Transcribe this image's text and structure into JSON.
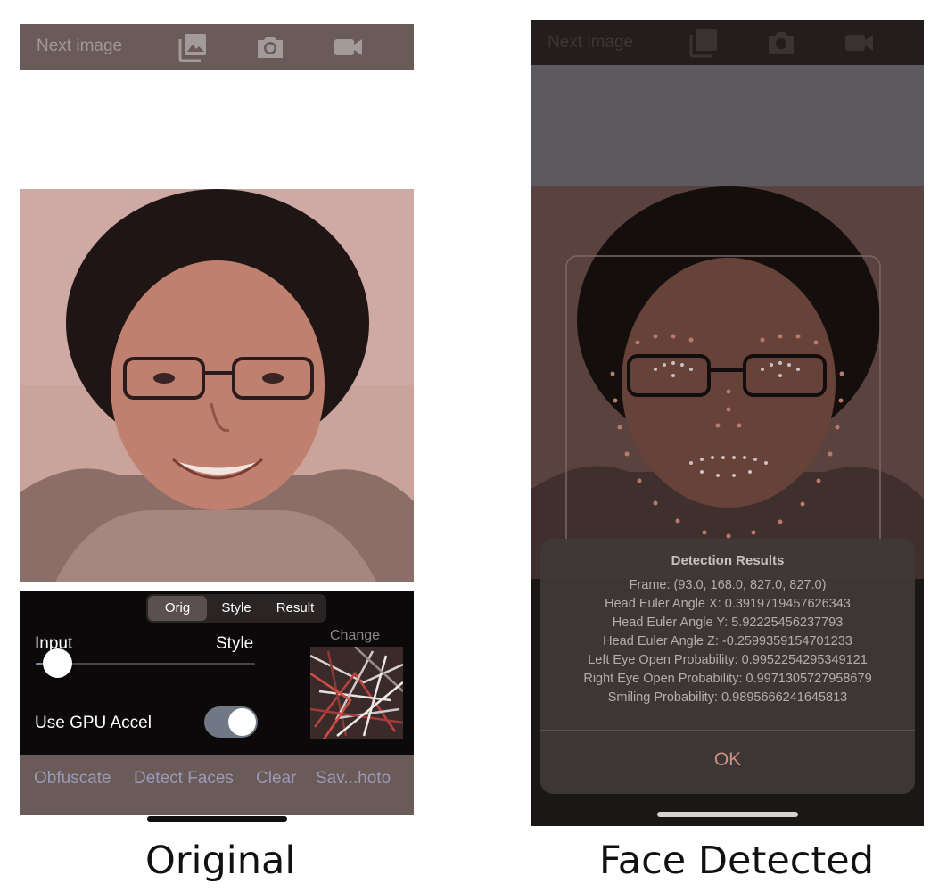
{
  "original": {
    "caption": "Original",
    "toolbar": {
      "next_label": "Next image",
      "icons": [
        "photo-library-icon",
        "camera-icon",
        "video-icon"
      ]
    },
    "segments": [
      "Orig",
      "Style",
      "Result"
    ],
    "selected_segment": "Orig",
    "slider": {
      "left_label": "Input",
      "right_label": "Style",
      "value": 0.1
    },
    "change_label": "Change",
    "gpu": {
      "label": "Use GPU Accel",
      "on": true
    },
    "actions": [
      "Obfuscate",
      "Detect Faces",
      "Clear",
      "Sav...hoto"
    ]
  },
  "detected": {
    "caption": "Face Detected",
    "toolbar": {
      "next_label": "Next image"
    },
    "alert": {
      "title": "Detection Results",
      "lines": [
        "Frame: (93.0, 168.0, 827.0, 827.0)",
        "Head Euler Angle X: 0.3919719457626343",
        "Head Euler Angle Y: 5.92225456237793",
        "Head Euler Angle Z: -0.2599359154701233",
        "Left Eye Open Probability: 0.9952254295349121",
        "Right Eye Open Probability: 0.9971305727958679",
        "Smiling Probability: 0.9895666241645813"
      ],
      "ok_label": "OK"
    }
  },
  "colors": {
    "bar": "#6a5a58",
    "panel": "#0b0909",
    "action_text": "#989ab8",
    "ok_text": "#cf8e80"
  }
}
